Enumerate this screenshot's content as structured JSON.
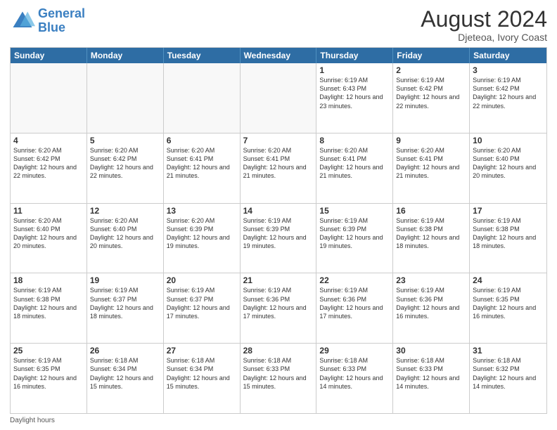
{
  "header": {
    "logo_general": "General",
    "logo_blue": "Blue",
    "month_title": "August 2024",
    "location": "Djeteoa, Ivory Coast"
  },
  "days_of_week": [
    "Sunday",
    "Monday",
    "Tuesday",
    "Wednesday",
    "Thursday",
    "Friday",
    "Saturday"
  ],
  "footer": {
    "label": "Daylight hours"
  },
  "rows": [
    {
      "cells": [
        {
          "day": "",
          "empty": true
        },
        {
          "day": "",
          "empty": true
        },
        {
          "day": "",
          "empty": true
        },
        {
          "day": "",
          "empty": true
        },
        {
          "day": "1",
          "sunrise": "Sunrise: 6:19 AM",
          "sunset": "Sunset: 6:43 PM",
          "daylight": "Daylight: 12 hours and 23 minutes."
        },
        {
          "day": "2",
          "sunrise": "Sunrise: 6:19 AM",
          "sunset": "Sunset: 6:42 PM",
          "daylight": "Daylight: 12 hours and 22 minutes."
        },
        {
          "day": "3",
          "sunrise": "Sunrise: 6:19 AM",
          "sunset": "Sunset: 6:42 PM",
          "daylight": "Daylight: 12 hours and 22 minutes."
        }
      ]
    },
    {
      "cells": [
        {
          "day": "4",
          "sunrise": "Sunrise: 6:20 AM",
          "sunset": "Sunset: 6:42 PM",
          "daylight": "Daylight: 12 hours and 22 minutes."
        },
        {
          "day": "5",
          "sunrise": "Sunrise: 6:20 AM",
          "sunset": "Sunset: 6:42 PM",
          "daylight": "Daylight: 12 hours and 22 minutes."
        },
        {
          "day": "6",
          "sunrise": "Sunrise: 6:20 AM",
          "sunset": "Sunset: 6:41 PM",
          "daylight": "Daylight: 12 hours and 21 minutes."
        },
        {
          "day": "7",
          "sunrise": "Sunrise: 6:20 AM",
          "sunset": "Sunset: 6:41 PM",
          "daylight": "Daylight: 12 hours and 21 minutes."
        },
        {
          "day": "8",
          "sunrise": "Sunrise: 6:20 AM",
          "sunset": "Sunset: 6:41 PM",
          "daylight": "Daylight: 12 hours and 21 minutes."
        },
        {
          "day": "9",
          "sunrise": "Sunrise: 6:20 AM",
          "sunset": "Sunset: 6:41 PM",
          "daylight": "Daylight: 12 hours and 21 minutes."
        },
        {
          "day": "10",
          "sunrise": "Sunrise: 6:20 AM",
          "sunset": "Sunset: 6:40 PM",
          "daylight": "Daylight: 12 hours and 20 minutes."
        }
      ]
    },
    {
      "cells": [
        {
          "day": "11",
          "sunrise": "Sunrise: 6:20 AM",
          "sunset": "Sunset: 6:40 PM",
          "daylight": "Daylight: 12 hours and 20 minutes."
        },
        {
          "day": "12",
          "sunrise": "Sunrise: 6:20 AM",
          "sunset": "Sunset: 6:40 PM",
          "daylight": "Daylight: 12 hours and 20 minutes."
        },
        {
          "day": "13",
          "sunrise": "Sunrise: 6:20 AM",
          "sunset": "Sunset: 6:39 PM",
          "daylight": "Daylight: 12 hours and 19 minutes."
        },
        {
          "day": "14",
          "sunrise": "Sunrise: 6:19 AM",
          "sunset": "Sunset: 6:39 PM",
          "daylight": "Daylight: 12 hours and 19 minutes."
        },
        {
          "day": "15",
          "sunrise": "Sunrise: 6:19 AM",
          "sunset": "Sunset: 6:39 PM",
          "daylight": "Daylight: 12 hours and 19 minutes."
        },
        {
          "day": "16",
          "sunrise": "Sunrise: 6:19 AM",
          "sunset": "Sunset: 6:38 PM",
          "daylight": "Daylight: 12 hours and 18 minutes."
        },
        {
          "day": "17",
          "sunrise": "Sunrise: 6:19 AM",
          "sunset": "Sunset: 6:38 PM",
          "daylight": "Daylight: 12 hours and 18 minutes."
        }
      ]
    },
    {
      "cells": [
        {
          "day": "18",
          "sunrise": "Sunrise: 6:19 AM",
          "sunset": "Sunset: 6:38 PM",
          "daylight": "Daylight: 12 hours and 18 minutes."
        },
        {
          "day": "19",
          "sunrise": "Sunrise: 6:19 AM",
          "sunset": "Sunset: 6:37 PM",
          "daylight": "Daylight: 12 hours and 18 minutes."
        },
        {
          "day": "20",
          "sunrise": "Sunrise: 6:19 AM",
          "sunset": "Sunset: 6:37 PM",
          "daylight": "Daylight: 12 hours and 17 minutes."
        },
        {
          "day": "21",
          "sunrise": "Sunrise: 6:19 AM",
          "sunset": "Sunset: 6:36 PM",
          "daylight": "Daylight: 12 hours and 17 minutes."
        },
        {
          "day": "22",
          "sunrise": "Sunrise: 6:19 AM",
          "sunset": "Sunset: 6:36 PM",
          "daylight": "Daylight: 12 hours and 17 minutes."
        },
        {
          "day": "23",
          "sunrise": "Sunrise: 6:19 AM",
          "sunset": "Sunset: 6:36 PM",
          "daylight": "Daylight: 12 hours and 16 minutes."
        },
        {
          "day": "24",
          "sunrise": "Sunrise: 6:19 AM",
          "sunset": "Sunset: 6:35 PM",
          "daylight": "Daylight: 12 hours and 16 minutes."
        }
      ]
    },
    {
      "cells": [
        {
          "day": "25",
          "sunrise": "Sunrise: 6:19 AM",
          "sunset": "Sunset: 6:35 PM",
          "daylight": "Daylight: 12 hours and 16 minutes."
        },
        {
          "day": "26",
          "sunrise": "Sunrise: 6:18 AM",
          "sunset": "Sunset: 6:34 PM",
          "daylight": "Daylight: 12 hours and 15 minutes."
        },
        {
          "day": "27",
          "sunrise": "Sunrise: 6:18 AM",
          "sunset": "Sunset: 6:34 PM",
          "daylight": "Daylight: 12 hours and 15 minutes."
        },
        {
          "day": "28",
          "sunrise": "Sunrise: 6:18 AM",
          "sunset": "Sunset: 6:33 PM",
          "daylight": "Daylight: 12 hours and 15 minutes."
        },
        {
          "day": "29",
          "sunrise": "Sunrise: 6:18 AM",
          "sunset": "Sunset: 6:33 PM",
          "daylight": "Daylight: 12 hours and 14 minutes."
        },
        {
          "day": "30",
          "sunrise": "Sunrise: 6:18 AM",
          "sunset": "Sunset: 6:33 PM",
          "daylight": "Daylight: 12 hours and 14 minutes."
        },
        {
          "day": "31",
          "sunrise": "Sunrise: 6:18 AM",
          "sunset": "Sunset: 6:32 PM",
          "daylight": "Daylight: 12 hours and 14 minutes."
        }
      ]
    }
  ]
}
